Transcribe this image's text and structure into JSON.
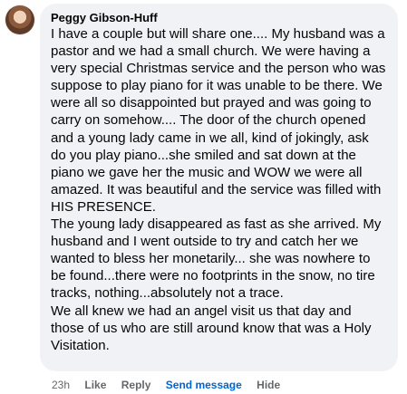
{
  "comment": {
    "author": "Peggy Gibson-Huff",
    "paragraphs": [
      "I have a couple but will share one.... My husband was a pastor and we had a small church. We were having a very special Christmas service and the person who was suppose to play piano for it was unable to be there. We were all so disappointed but prayed and was going to carry on somehow.... The door of the church opened and a young lady came in we all, kind of jokingly, ask do you play piano...she smiled and sat down at the piano we gave her the music and WOW we were all amazed. It was beautiful and the service was filled with HIS PRESENCE.",
      "The young lady disappeared as fast as she arrived. My husband and I went outside to try and catch her we wanted to bless her monetarily... she was nowhere to be found...there were no footprints in the snow, no tire tracks, nothing...absolutely not a trace.",
      "We all knew we had an angel visit us that day and those of us who are still around know that was a Holy Visitation."
    ]
  },
  "actions": {
    "time": "23h",
    "like": "Like",
    "reply": "Reply",
    "send_message": "Send message",
    "hide": "Hide"
  },
  "colors": {
    "bubble_bg": "#f0f2f5",
    "text": "#050505",
    "secondary": "#65676b",
    "link": "#0064d1"
  }
}
